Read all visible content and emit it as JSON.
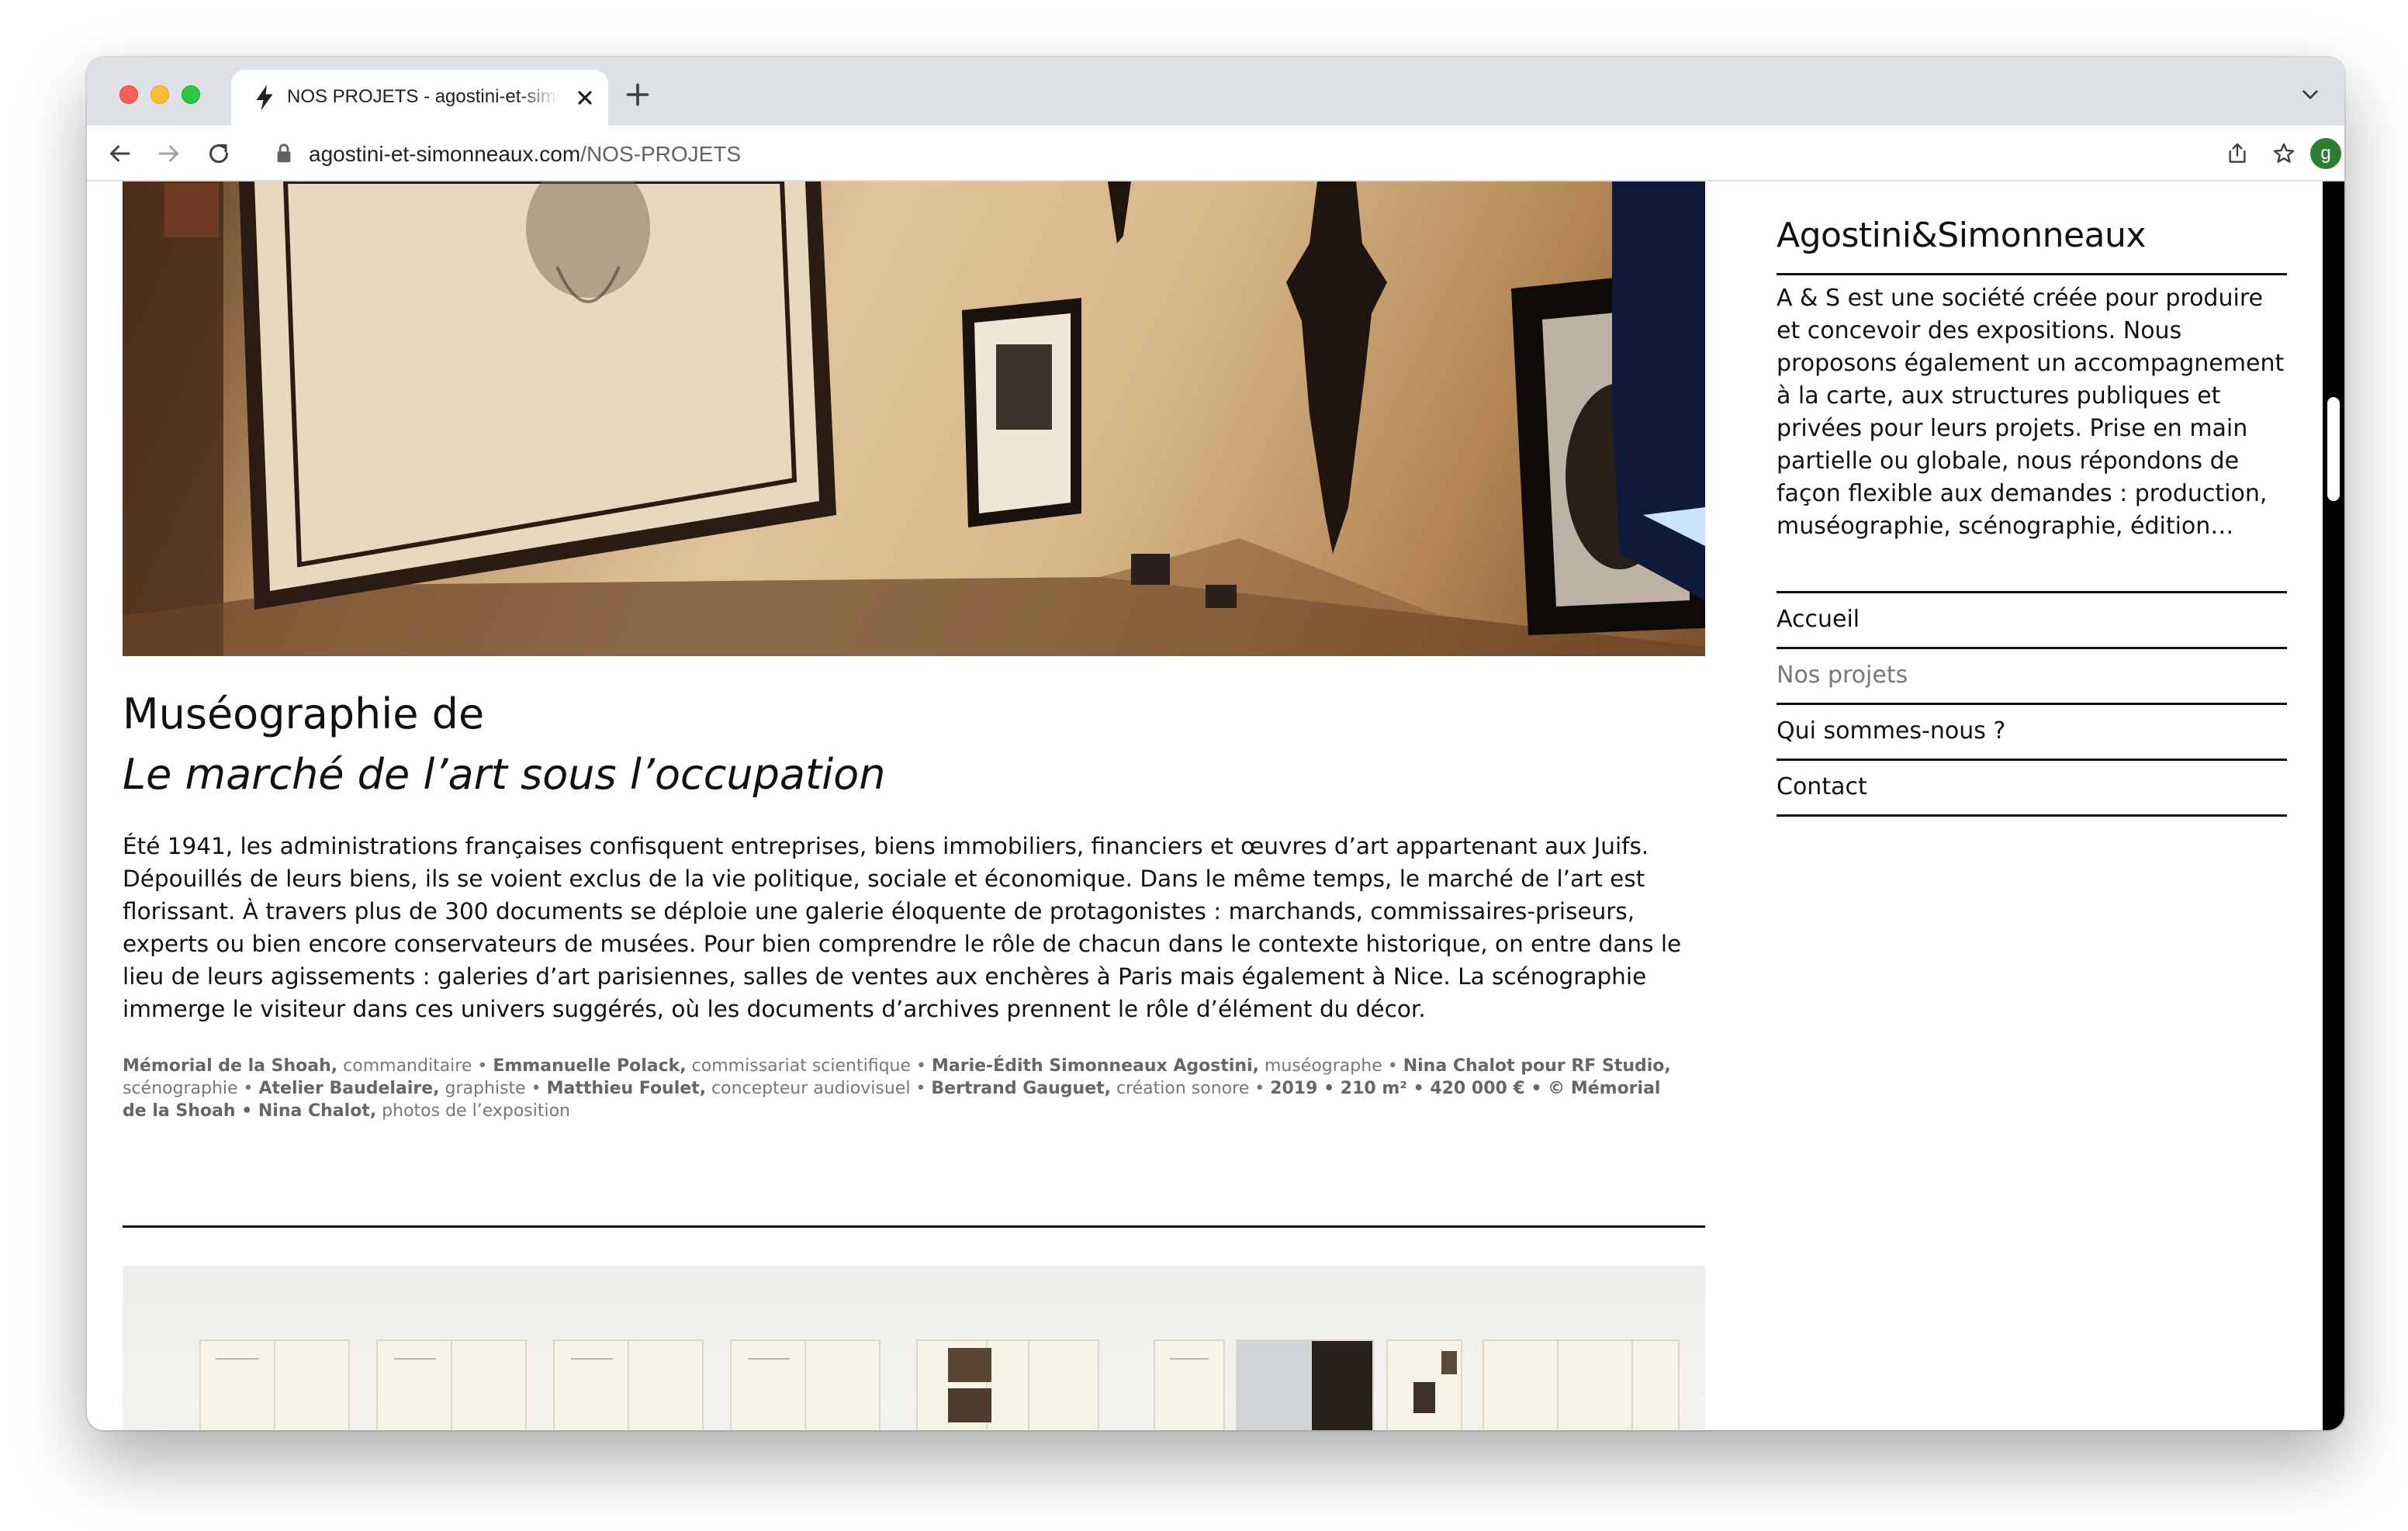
{
  "browser": {
    "tab_title": "NOS PROJETS - agostini-et-simonneaux",
    "url_domain": "agostini-et-simonneaux.com",
    "url_path": "/NOS-PROJETS",
    "avatar_letter": "g"
  },
  "project": {
    "title_line1": "Muséographie de",
    "title_line2": "Le marché de l’art sous l’occupation",
    "description": "Été 1941, les administrations françaises confisquent entreprises, biens immobiliers, financiers et œuvres d’art appartenant aux Juifs. Dépouillés de leurs biens, ils se voient exclus de la vie politique, sociale et économique. Dans le même temps, le marché de l’art est florissant. À travers plus de 300 documents se déploie une galerie éloquente de protagonistes : marchands, commissaires-priseurs, experts ou bien encore conservateurs de musées. Pour bien comprendre le rôle de chacun dans le contexte historique, on entre dans le lieu de leurs agissements : galeries d’art parisiennes, salles de ventes aux enchères à Paris mais également à Nice. La scénographie immerge le visiteur dans ces univers suggérés, où les documents d’archives prennent le rôle d’élément du décor.",
    "credits": [
      {
        "name": "Mémorial de la Shoah,",
        "role": " commanditaire • "
      },
      {
        "name": "Emmanuelle Polack,",
        "role": " commissariat scientifique • "
      },
      {
        "name": "Marie-Édith Simonneaux Agostini,",
        "role": " muséographe • "
      },
      {
        "name": "Nina Chalot pour RF Studio,",
        "role": " scénographie • "
      },
      {
        "name": "Atelier Baudelaire,",
        "role": " graphiste • "
      },
      {
        "name": "Matthieu Foulet,",
        "role": " concepteur audiovisuel • "
      },
      {
        "name": "Bertrand Gauguet,",
        "role": " création sonore • "
      },
      {
        "name": "2019 • 210 m² • 420 000 € • © Mémorial de la Shoah • Nina Chalot,",
        "role": " photos de l’exposition"
      }
    ]
  },
  "sidebar": {
    "brand": "Agostini&Simonneaux",
    "about": "A & S est une société créée pour produire et concevoir des expositions. Nous proposons également un accompagnement à la carte, aux structures publiques et privées pour leurs projets. Prise en main partielle ou globale, nous répondons de façon flexible aux demandes : production, muséographie, scénographie, édition…",
    "nav": [
      {
        "label": "Accueil",
        "active": false
      },
      {
        "label": "Nos projets",
        "active": true
      },
      {
        "label": "Qui sommes-nous ?",
        "active": false
      },
      {
        "label": "Contact",
        "active": false
      }
    ]
  }
}
